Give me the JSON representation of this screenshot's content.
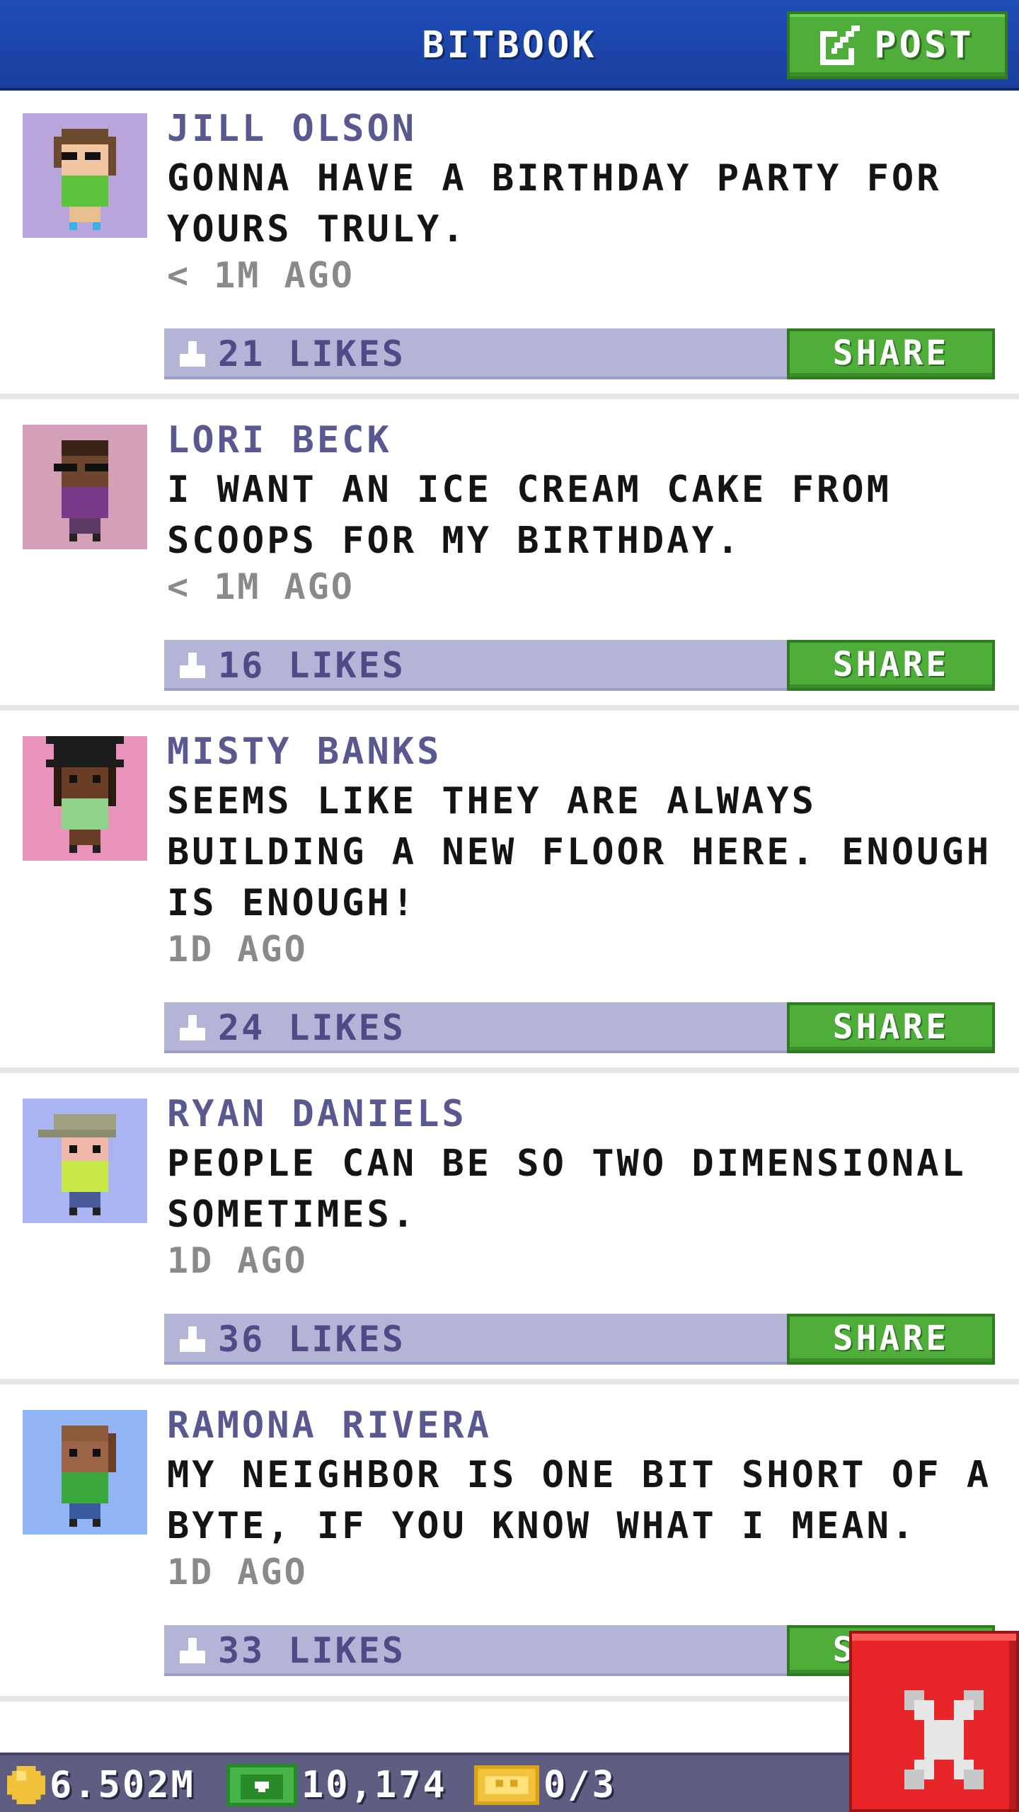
{
  "header": {
    "title": "BITBOOK",
    "post_label": "POST"
  },
  "posts": [
    {
      "author": "JILL OLSON",
      "message": "GONNA HAVE A BIRTHDAY PARTY FOR YOURS TRULY.",
      "time": "< 1M AGO",
      "likes": "21 LIKES",
      "share_label": "SHARE",
      "avatar_bg": "#b9a4dc"
    },
    {
      "author": "LORI BECK",
      "message": "I WANT AN ICE CREAM CAKE FROM SCOOPS FOR MY BIRTHDAY.",
      "time": "< 1M AGO",
      "likes": "16 LIKES",
      "share_label": "SHARE",
      "avatar_bg": "#d4a0b8"
    },
    {
      "author": "MISTY BANKS",
      "message": "SEEMS LIKE THEY ARE ALWAYS BUILDING A NEW FLOOR HERE. ENOUGH IS ENOUGH!",
      "time": "1D AGO",
      "likes": "24 LIKES",
      "share_label": "SHARE",
      "avatar_bg": "#e892bc"
    },
    {
      "author": "RYAN DANIELS",
      "message": "PEOPLE CAN BE SO TWO DIMENSIONAL SOMETIMES.",
      "time": "1D AGO",
      "likes": "36 LIKES",
      "share_label": "SHARE",
      "avatar_bg": "#a9b4f0"
    },
    {
      "author": "RAMONA RIVERA",
      "message": "MY NEIGHBOR IS ONE BIT SHORT OF A BYTE, IF YOU KNOW WHAT I MEAN.",
      "time": "1D AGO",
      "likes": "33 LIKES",
      "share_label": "SHARE",
      "avatar_bg": "#90b4f4"
    }
  ],
  "bottom_bar": {
    "coins": "6.502M",
    "bux": "10,174",
    "tickets": "0/3"
  },
  "colors": {
    "header_blue": "#1f4db8",
    "button_green": "#4fae3a",
    "likes_bar": "#b4b4d6",
    "author_purple": "#5a5890",
    "close_red": "#e8262a"
  },
  "icons": [
    "edit-icon",
    "thumbs-up-icon",
    "coin-icon",
    "bux-icon",
    "ticket-icon",
    "close-icon"
  ]
}
